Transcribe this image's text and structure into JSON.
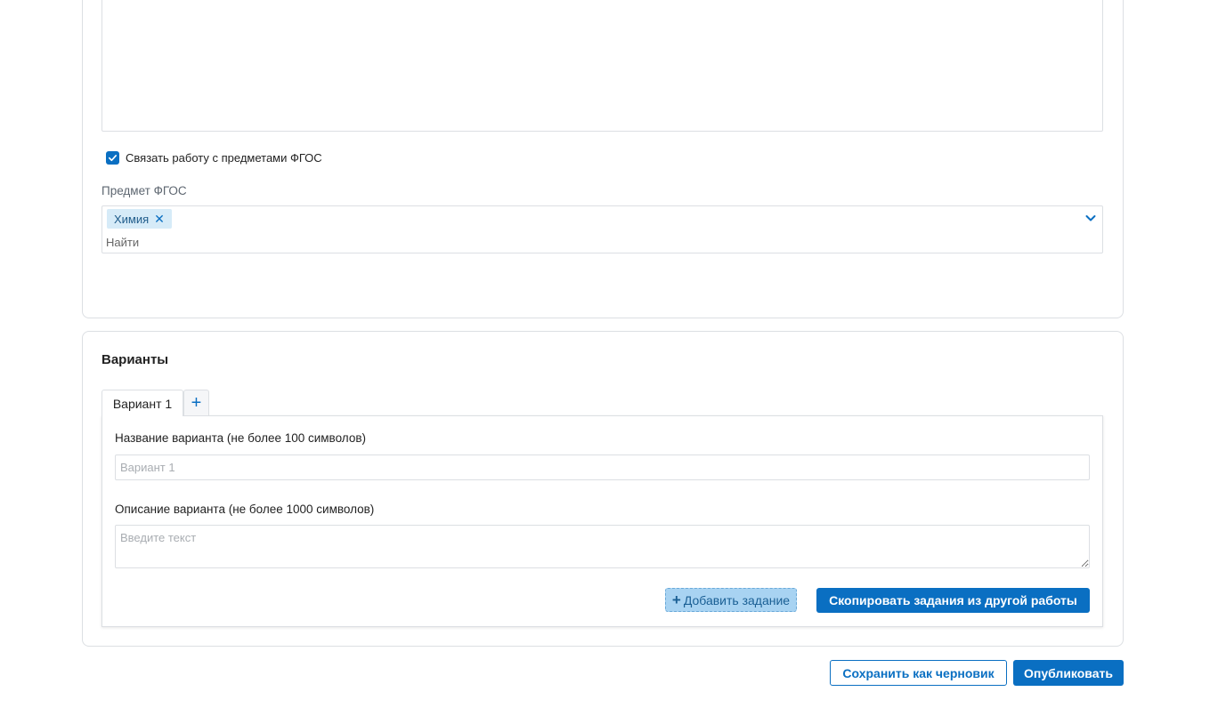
{
  "fgos": {
    "link_checkbox_label": "Связать работу с предметами ФГОС",
    "link_checked": true,
    "subject_label": "Предмет ФГОС",
    "selected_subjects": [
      "Химия"
    ],
    "search_placeholder": "Найти"
  },
  "variants": {
    "title": "Варианты",
    "tabs": [
      {
        "label": "Вариант 1",
        "active": true
      }
    ],
    "add_tab_symbol": "+",
    "name_label": "Название варианта (не более 100 символов)",
    "name_placeholder": "Вариант 1",
    "description_label": "Описание варианта (не более 1000 символов)",
    "description_placeholder": "Введите текст",
    "add_task_label": "Добавить задание",
    "copy_tasks_label": "Скопировать задания из другой работы"
  },
  "footer": {
    "save_draft_label": "Сохранить как черновик",
    "publish_label": "Опубликовать"
  },
  "colors": {
    "primary": "#0a6fc2",
    "tag_bg": "#d6ebf8",
    "border": "#dcdfe3"
  }
}
